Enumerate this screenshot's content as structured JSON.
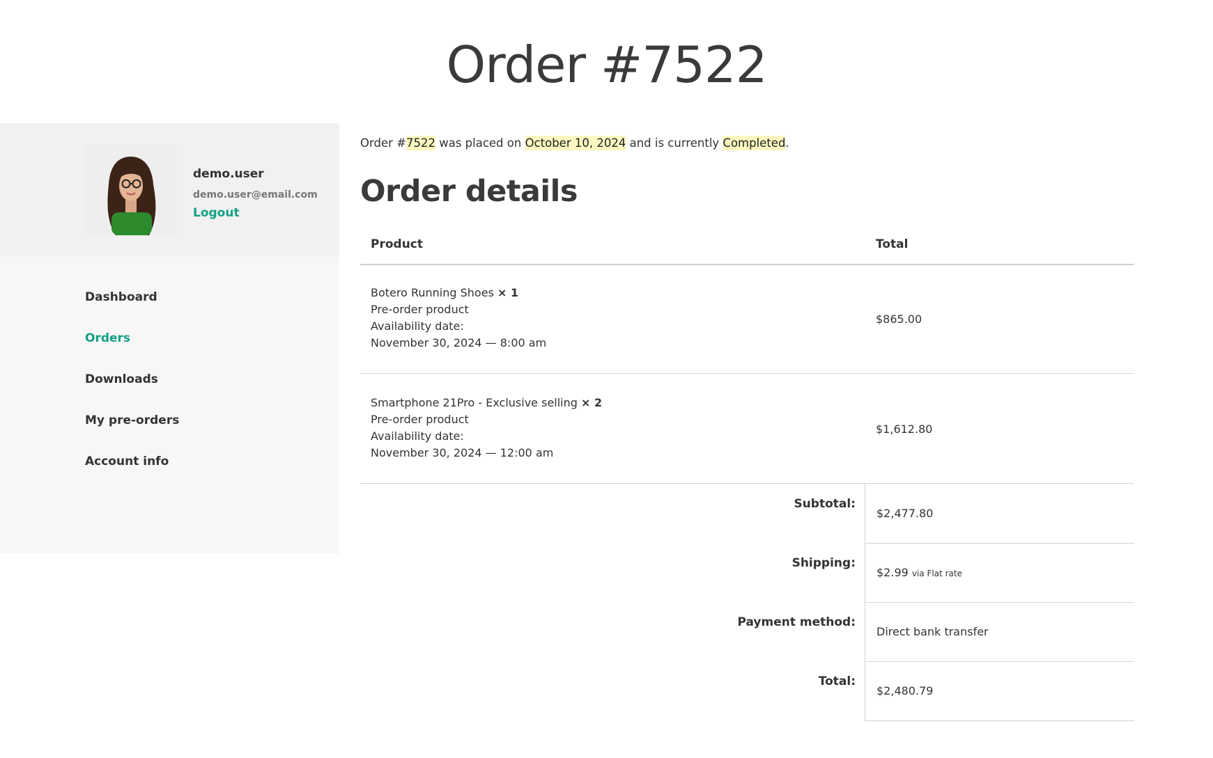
{
  "page": {
    "title": "Order #7522"
  },
  "sidebar": {
    "user": {
      "name": "demo.user",
      "email": "demo.user@email.com",
      "logout_label": "Logout"
    },
    "nav": [
      {
        "label": "Dashboard"
      },
      {
        "label": "Orders",
        "active": true
      },
      {
        "label": "Downloads"
      },
      {
        "label": "My pre-orders"
      },
      {
        "label": "Account info"
      }
    ]
  },
  "notice": {
    "prefix": "Order #",
    "order_number": "7522",
    "placed_text": " was placed on ",
    "date": "October 10, 2024",
    "status_text": " and is currently ",
    "status": "Completed",
    "suffix": "."
  },
  "order_details": {
    "title": "Order details",
    "headers": {
      "product": "Product",
      "total": "Total"
    },
    "items": [
      {
        "name": "Botero Running Shoes",
        "qty": "× 1",
        "line1": "Pre-order product",
        "line2": "Availability date:",
        "line3": "November 30, 2024 — 8:00 am",
        "total": "$865.00"
      },
      {
        "name": "Smartphone 21Pro - Exclusive selling",
        "qty": "× 2",
        "line1": "Pre-order product",
        "line2": "Availability date:",
        "line3": "November 30, 2024 — 12:00 am",
        "total": "$1,612.80"
      }
    ],
    "totals": {
      "subtotal_label": "Subtotal:",
      "subtotal": "$2,477.80",
      "shipping_label": "Shipping:",
      "shipping": "$2.99",
      "shipping_via": "via Flat rate",
      "payment_label": "Payment method:",
      "payment": "Direct bank transfer",
      "total_label": "Total:",
      "total": "$2,480.79"
    }
  },
  "colors": {
    "accent": "#12a085",
    "highlight": "#fcf7c0"
  }
}
